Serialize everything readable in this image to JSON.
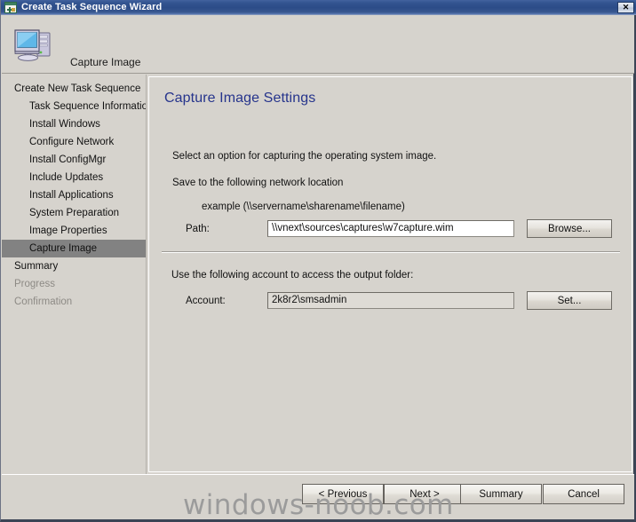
{
  "window": {
    "title": "Create Task Sequence Wizard",
    "title_icon": "task-sequence-icon",
    "close_label": "✕",
    "titlebar_color": "#2c4c88",
    "face_color": "#d6d3cd"
  },
  "header": {
    "icon": "computer-icon",
    "title": "Capture Image"
  },
  "sidebar": {
    "items": [
      {
        "label": "Create New Task Sequence",
        "level": 0,
        "state": "normal"
      },
      {
        "label": "Task Sequence Information",
        "level": 1,
        "state": "normal"
      },
      {
        "label": "Install Windows",
        "level": 1,
        "state": "normal"
      },
      {
        "label": "Configure Network",
        "level": 1,
        "state": "normal"
      },
      {
        "label": "Install ConfigMgr",
        "level": 1,
        "state": "normal"
      },
      {
        "label": "Include Updates",
        "level": 1,
        "state": "normal"
      },
      {
        "label": "Install Applications",
        "level": 1,
        "state": "normal"
      },
      {
        "label": "System Preparation",
        "level": 1,
        "state": "normal"
      },
      {
        "label": "Image Properties",
        "level": 1,
        "state": "normal"
      },
      {
        "label": "Capture Image",
        "level": 1,
        "state": "selected"
      },
      {
        "label": "Summary",
        "level": 0,
        "state": "normal"
      },
      {
        "label": "Progress",
        "level": 0,
        "state": "disabled"
      },
      {
        "label": "Confirmation",
        "level": 0,
        "state": "disabled"
      }
    ],
    "selected_color": "#828282",
    "scrollbar": {
      "left_arrow": "◀",
      "right_arrow": "▶"
    }
  },
  "content": {
    "title": "Capture Image Settings",
    "title_color": "#26348c",
    "intro_text": "Select an option for capturing the operating system image.",
    "save_location_label": "Save to the following network location",
    "example_text": "example (\\\\servername\\sharename\\filename)",
    "path": {
      "label": "Path:",
      "value": "\\\\vnext\\sources\\captures\\w7capture.wim",
      "placeholder": "",
      "browse_button": "Browse..."
    },
    "account_section_label": "Use the following account to access the output folder:",
    "account": {
      "label": "Account:",
      "value": "2k8r2\\smsadmin",
      "placeholder": "",
      "set_button": "Set..."
    }
  },
  "footer": {
    "previous": "< Previous",
    "next": "Next >",
    "summary": "Summary",
    "cancel": "Cancel"
  },
  "watermark": {
    "text": "windows-noob.com"
  }
}
